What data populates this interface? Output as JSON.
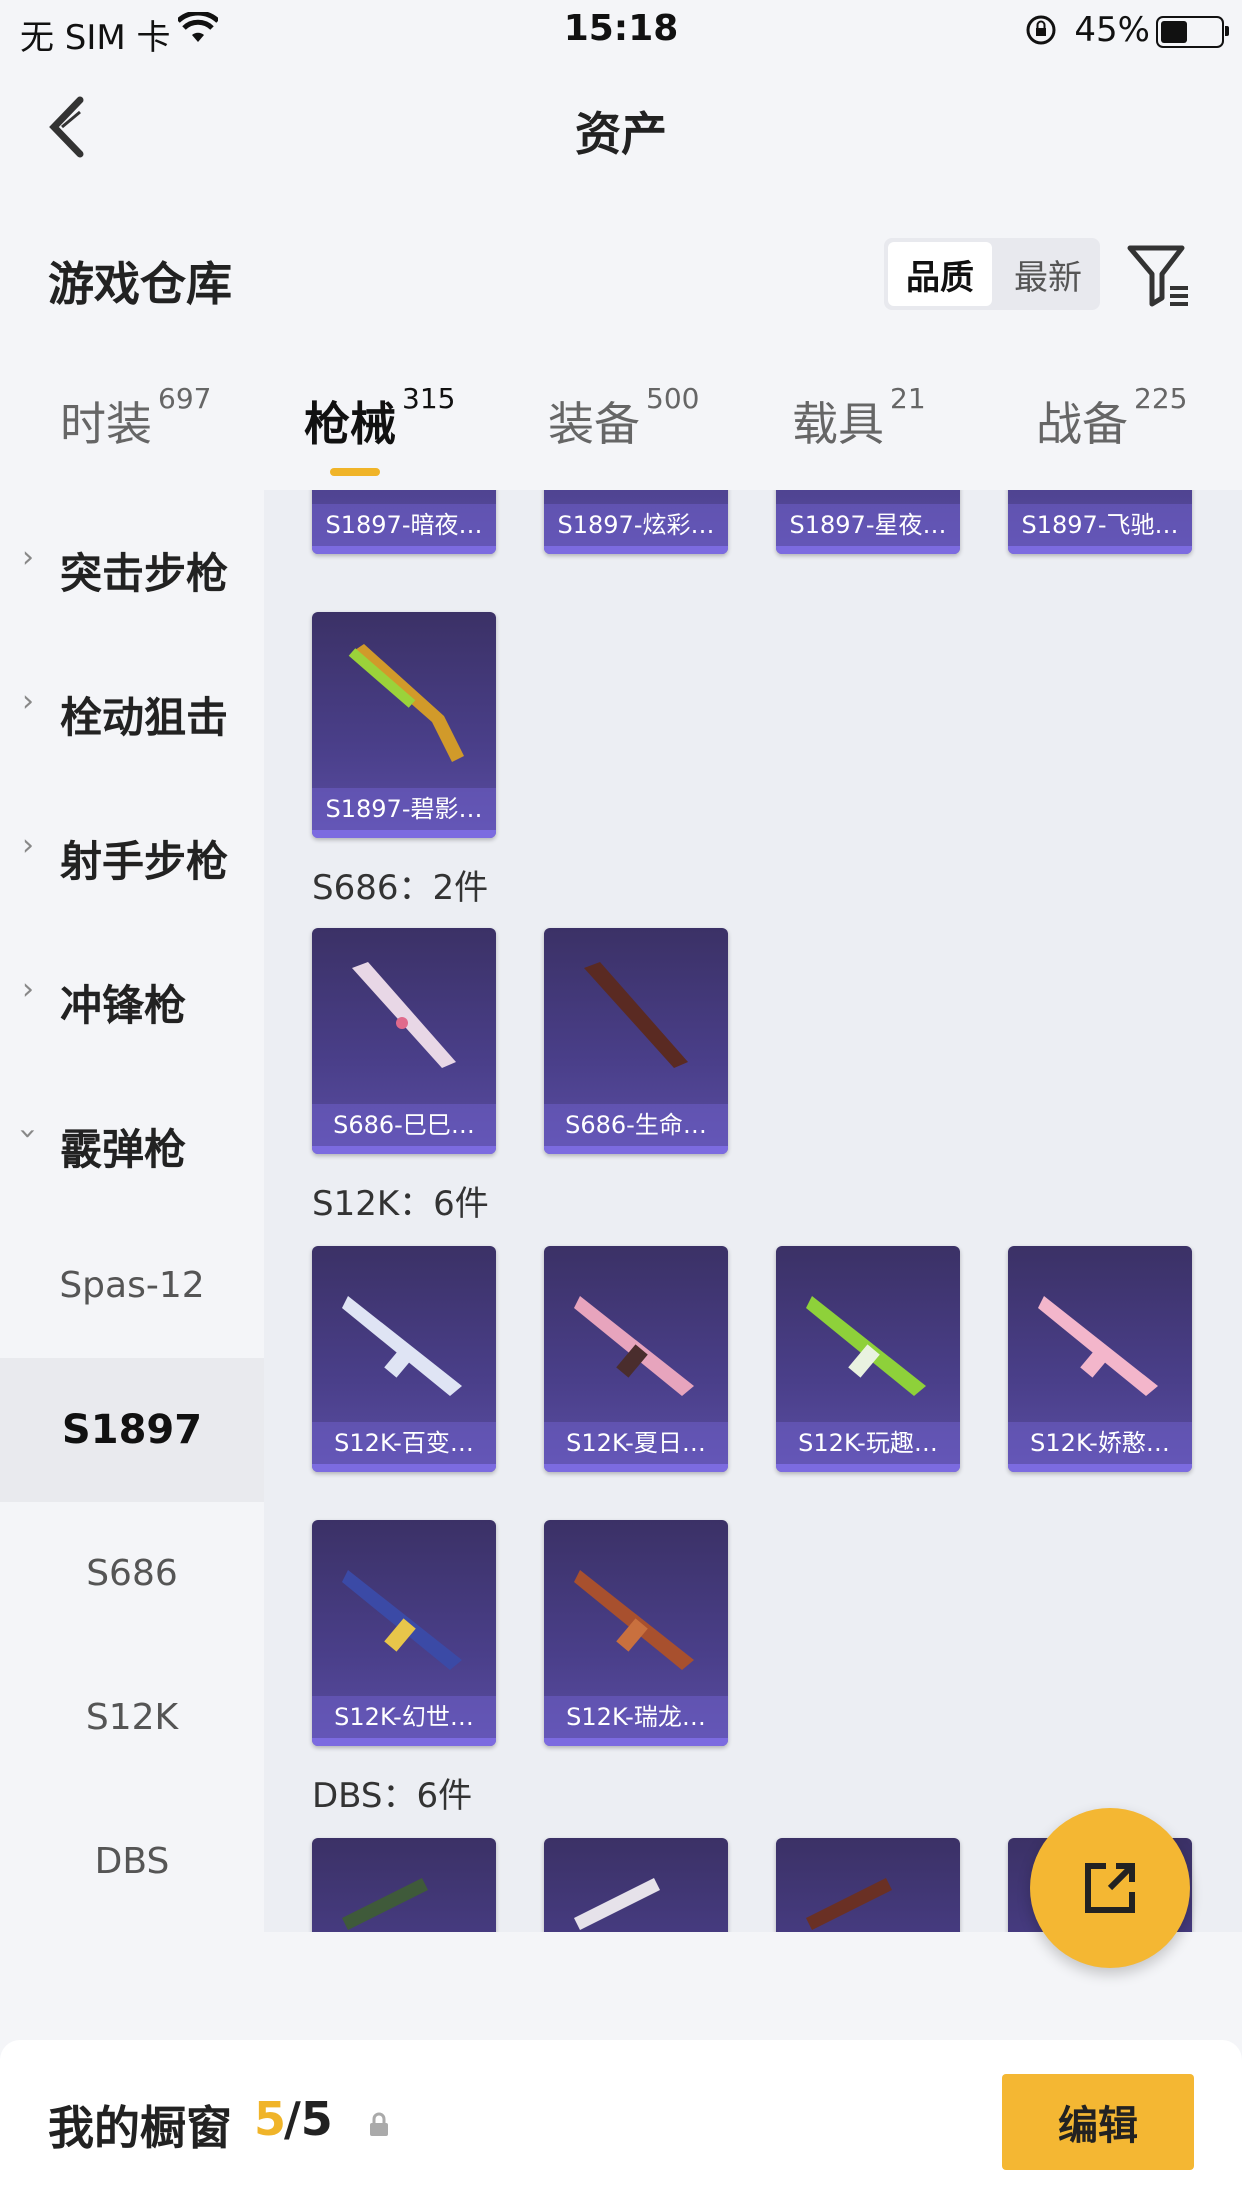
{
  "status_bar": {
    "carrier": "无 SIM 卡",
    "time": "15:18",
    "battery_pct": "45%",
    "battery_level": 0.45
  },
  "nav": {
    "title": "资产"
  },
  "header": {
    "warehouse_title": "游戏仓库",
    "sort_options": [
      "品质",
      "最新"
    ],
    "active_sort": "品质"
  },
  "tabs": [
    {
      "label": "时装",
      "count": "697"
    },
    {
      "label": "枪械",
      "count": "315"
    },
    {
      "label": "装备",
      "count": "500"
    },
    {
      "label": "载具",
      "count": "21"
    },
    {
      "label": "战备",
      "count": "225"
    }
  ],
  "active_tab": "枪械",
  "sidebar": {
    "categories": [
      "突击步枪",
      "栓动狙击",
      "射手步枪",
      "冲锋枪",
      "霰弹枪"
    ],
    "expanded": "霰弹枪",
    "subitems": [
      "Spas-12",
      "S1897",
      "S686",
      "S12K",
      "DBS"
    ],
    "active_sub": "S1897"
  },
  "content": {
    "top_row": [
      "S1897-暗夜…",
      "S1897-炫彩…",
      "S1897-星夜…",
      "S1897-飞驰…"
    ],
    "s1897_extra": [
      "S1897-碧影…"
    ],
    "groups": [
      {
        "heading": "S686：2件",
        "items": [
          "S686-巳巳…",
          "S686-生命…"
        ]
      },
      {
        "heading": "S12K：6件",
        "items": [
          "S12K-百变…",
          "S12K-夏日…",
          "S12K-玩趣…",
          "S12K-娇憨…",
          "S12K-幻世…",
          "S12K-瑞龙…"
        ]
      },
      {
        "heading": "DBS：6件",
        "items": [
          "",
          "",
          "",
          ""
        ]
      }
    ]
  },
  "bottom": {
    "label": "我的橱窗",
    "current": "5",
    "total": "/5",
    "edit_label": "编辑"
  },
  "colors": {
    "accent": "#f4b733",
    "card_bg": "#4a3f8a"
  },
  "icons": {
    "back": "back-chevron-icon",
    "filter": "filter-icon",
    "fab": "share-export-icon",
    "lock": "lock-icon"
  }
}
